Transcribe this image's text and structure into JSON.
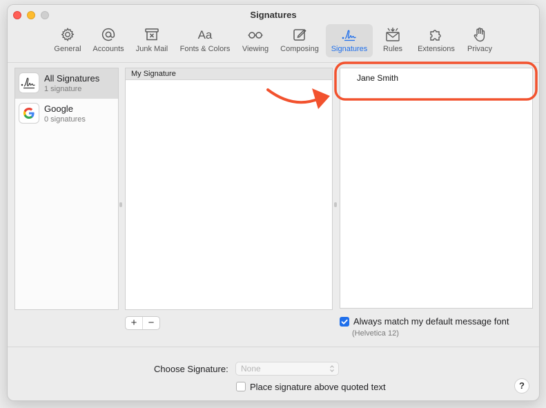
{
  "window": {
    "title": "Signatures"
  },
  "toolbar": {
    "items": [
      {
        "label": "General",
        "icon": "gear-icon"
      },
      {
        "label": "Accounts",
        "icon": "at-sign-icon"
      },
      {
        "label": "Junk Mail",
        "icon": "junk-mail-icon"
      },
      {
        "label": "Fonts & Colors",
        "icon": "fonts-icon"
      },
      {
        "label": "Viewing",
        "icon": "glasses-icon"
      },
      {
        "label": "Composing",
        "icon": "compose-icon"
      },
      {
        "label": "Signatures",
        "icon": "signature-icon",
        "active": true
      },
      {
        "label": "Rules",
        "icon": "rules-envelope-icon"
      },
      {
        "label": "Extensions",
        "icon": "puzzle-icon"
      },
      {
        "label": "Privacy",
        "icon": "hand-icon"
      }
    ]
  },
  "accounts": [
    {
      "name": "All Signatures",
      "count": "1 signature",
      "icon": "signature-icon",
      "selected": true
    },
    {
      "name": "Google",
      "count": "0 signatures",
      "icon": "google-logo-icon"
    }
  ],
  "signatures": {
    "header": "My Signature"
  },
  "preview": {
    "text": "Jane Smith"
  },
  "buttons": {
    "add": "+",
    "remove": "−"
  },
  "options": {
    "match_font_label": "Always match my default message font",
    "match_font_checked": true,
    "font_info": "(Helvetica 12)",
    "place_above_label": "Place signature above quoted text",
    "place_above_checked": false
  },
  "footer": {
    "choose_label": "Choose Signature:",
    "choose_value": "None",
    "help": "?"
  },
  "colors": {
    "accent": "#1f6feb",
    "annotation": "#f2522e"
  }
}
